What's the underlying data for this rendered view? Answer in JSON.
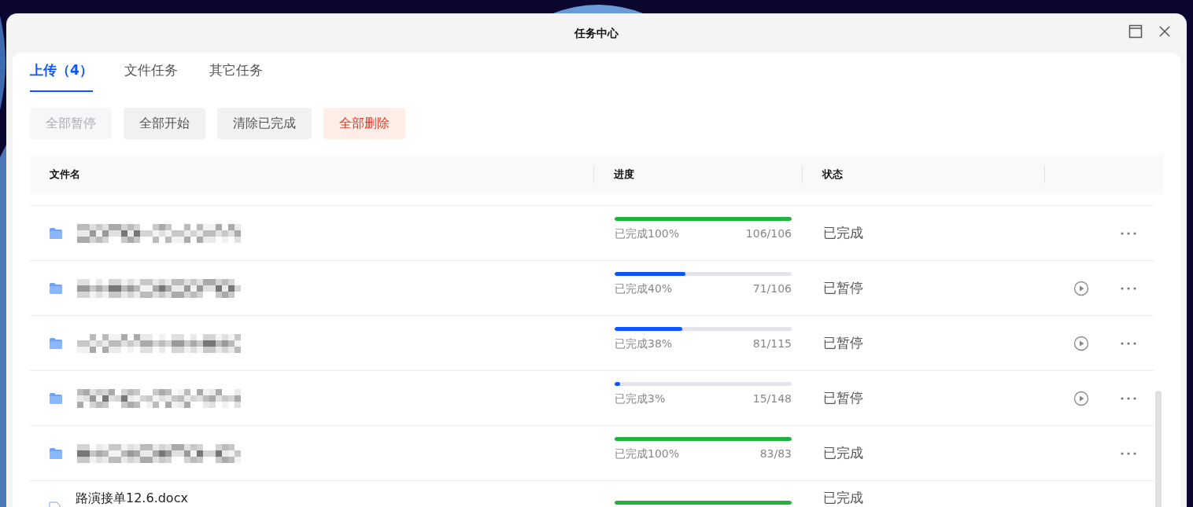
{
  "window": {
    "title": "任务中心"
  },
  "tabs": [
    {
      "label": "上传（4）",
      "selected": true
    },
    {
      "label": "文件任务",
      "selected": false
    },
    {
      "label": "其它任务",
      "selected": false
    }
  ],
  "actions": [
    {
      "label": "全部暂停",
      "kind": "normal",
      "disabled": true
    },
    {
      "label": "全部开始",
      "kind": "normal",
      "disabled": false
    },
    {
      "label": "清除已完成",
      "kind": "normal",
      "disabled": false
    },
    {
      "label": "全部删除",
      "kind": "danger",
      "disabled": false
    }
  ],
  "table": {
    "columns": [
      "文件名",
      "进度",
      "状态"
    ],
    "rows": [
      {
        "kind": "folder",
        "redacted": true,
        "level": 1,
        "progress_text": "已完成100%",
        "count": "106/106",
        "status": "已完成"
      },
      {
        "kind": "folder",
        "redacted": true,
        "level": 0.4,
        "progress_text": "已完成40%",
        "count": "71/106",
        "status": "已暂停"
      },
      {
        "kind": "folder",
        "redacted": true,
        "level": 0.38,
        "progress_text": "已完成38%",
        "count": "81/115",
        "status": "已暂停"
      },
      {
        "kind": "folder",
        "redacted": true,
        "level": 0.03,
        "progress_text": "已完成3%",
        "count": "15/148",
        "status": "已暂停"
      },
      {
        "kind": "folder",
        "redacted": true,
        "level": 1,
        "progress_text": "已完成100%",
        "count": "83/83",
        "status": "已完成"
      },
      {
        "kind": "word",
        "redacted": false,
        "name": "路演接单12.6.docx",
        "level": 1,
        "status": "已完成"
      }
    ]
  }
}
